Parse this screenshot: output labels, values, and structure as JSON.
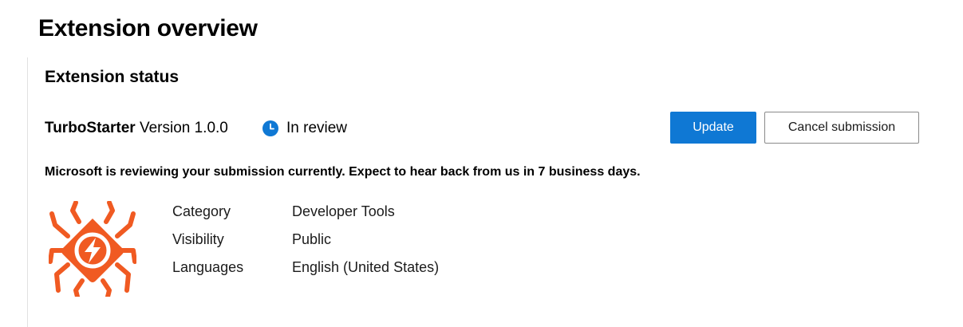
{
  "page": {
    "title": "Extension overview"
  },
  "panel": {
    "title": "Extension status",
    "extension": {
      "name": "TurboStarter",
      "version_text": "Version 1.0.0",
      "status_icon": "clock-icon",
      "status_text": "In review",
      "status_color": "#0f78d4"
    },
    "actions": {
      "update_label": "Update",
      "cancel_label": "Cancel submission"
    },
    "message": "Microsoft is reviewing your submission currently. Expect to hear back from us in 7 business days.",
    "logo": {
      "icon": "spider-bolt-logo",
      "color": "#f05a22"
    },
    "details": [
      {
        "label": "Category",
        "value": "Developer Tools"
      },
      {
        "label": "Visibility",
        "value": "Public"
      },
      {
        "label": "Languages",
        "value": "English (United States)"
      }
    ]
  },
  "colors": {
    "accent": "#0f78d4",
    "logo": "#f05a22"
  }
}
